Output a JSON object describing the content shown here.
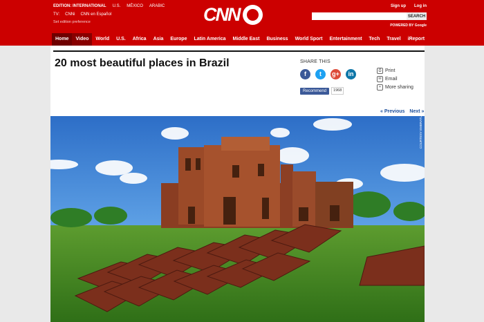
{
  "header": {
    "edition_label": "EDITION: INTERNATIONAL",
    "edition_links": [
      "U.S.",
      "MÉXICO",
      "ARABIC"
    ],
    "tv_label": "TV:",
    "tv_links": [
      "CNNi",
      "CNN en Español"
    ],
    "edition_pref": "Set edition preference",
    "logo_text": "CNN",
    "auth": {
      "signup": "Sign up",
      "login": "Log in"
    },
    "search": {
      "button": "SEARCH",
      "placeholder": ""
    },
    "powered": "POWERED BY",
    "google": "Google"
  },
  "nav": {
    "items": [
      "Home",
      "Video",
      "World",
      "U.S.",
      "Africa",
      "Asia",
      "Europe",
      "Latin America",
      "Middle East",
      "Business",
      "World Sport",
      "Entertainment",
      "Tech",
      "Travel",
      "iReport"
    ]
  },
  "article": {
    "headline": "20 most beautiful places in Brazil",
    "share_title": "SHARE THIS",
    "socials": [
      "f",
      "t",
      "g+",
      "in"
    ],
    "recommend": "Recommend",
    "recommend_count": "1968",
    "tools": [
      "Print",
      "Email",
      "More sharing"
    ],
    "pager": {
      "previous": "« Previous",
      "next": "Next »"
    },
    "credit": "COURTESY EMBRATUR"
  },
  "colors": {
    "brand_red": "#cc0000",
    "facebook": "#3b5998",
    "twitter": "#1da1f2",
    "google_plus": "#dd4b39",
    "linkedin": "#0e76a8"
  }
}
